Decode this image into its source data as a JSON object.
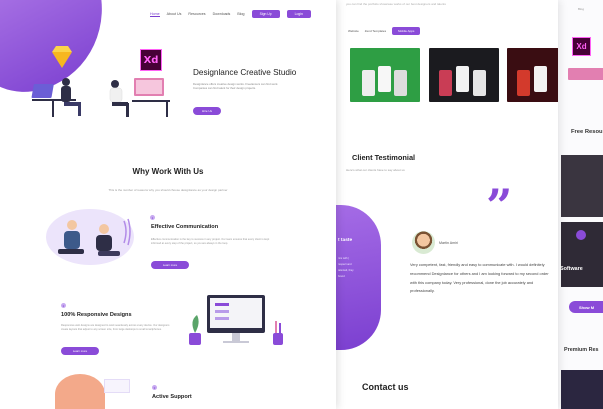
{
  "left": {
    "nav": [
      "Home",
      "About Us",
      "Resources",
      "Downloads",
      "Blog"
    ],
    "nav_signup": "Sign Up",
    "nav_login": "Login",
    "logo_xd": "Xd",
    "hero_title": "Designlance Creative Studio",
    "hero_desc": "Designlance offers creative design works. Freelancers can find work. Companies can find talent for their design projects.",
    "hero_button": "Hire Us",
    "why_title": "Why Work With Us",
    "why_subtitle": "This is the number of reasons why you should choose designlance as your design partner",
    "features": [
      {
        "num": "1",
        "title": "Effective Communication",
        "desc": "Effective communication is the key to success in any project. Our team ensures that every client is kept informed at every step of the project, so you are always in the loop.",
        "button": "Learn more"
      },
      {
        "num": "2",
        "title": "100% Responsive Designs",
        "desc": "Responsive web designs are designed to work seamlessly across every device. Our designers create layouts that adjust to any screen size, from large desktops to small smartphones.",
        "button": "Learn more"
      },
      {
        "num": "3",
        "title": "Active Support"
      }
    ]
  },
  "middle": {
    "top_text": "you can find the portfolio showcase works of our best designers and talents",
    "tabs": [
      "Website",
      "Zend Templates",
      "Mobile Apps"
    ],
    "testimonial_title": "Client Testimonial",
    "testimonial_sub": "Here's what our clients have to say about us",
    "blob_title": "t taste",
    "blob_lines": [
      "rice with |",
      "respect and",
      "talented, they",
      "brand"
    ],
    "quote_mark": "”",
    "author": "Martin Amiri",
    "review": "Very competent, fast, friendly and easy to communicate with. I would definitely recommend Designlance for others and I am looking forward to my second order with this company today. Very professional, done the job accurately and professionally.",
    "contact": "Contact us"
  },
  "right": {
    "nav": "Blog",
    "logo_xd": "Xd",
    "title": "Free Resou",
    "label": "Software",
    "button": "Show M",
    "title2": "Premium Res"
  },
  "colors": {
    "accent": "#8a4bd8",
    "xd_bg": "#470137",
    "xd_fg": "#ff61f6",
    "sketch": "#f7b71f"
  }
}
